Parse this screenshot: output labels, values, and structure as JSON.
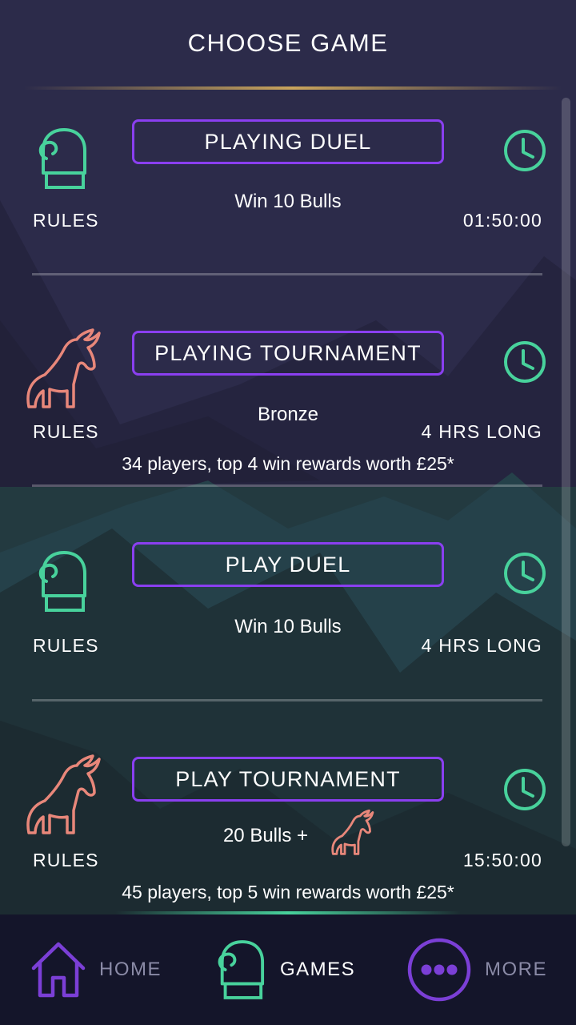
{
  "header": {
    "title": "CHOOSE GAME"
  },
  "cards": [
    {
      "button_label": "PLAYING DUEL",
      "subtitle": "Win 10 Bulls",
      "rules_label": "RULES",
      "time_label": "01:50:00",
      "icon": "boxing-glove-icon"
    },
    {
      "button_label": "PLAYING TOURNAMENT",
      "subtitle": "Bronze",
      "rules_label": "RULES",
      "time_label": "4 HRS LONG",
      "players_text": "34 players, top 4 win rewards worth £25*",
      "icon": "bull-icon"
    },
    {
      "button_label": "PLAY DUEL",
      "subtitle": "Win 10 Bulls",
      "rules_label": "RULES",
      "time_label": "4 HRS LONG",
      "icon": "boxing-glove-icon"
    },
    {
      "button_label": "PLAY TOURNAMENT",
      "subtitle": "20 Bulls +",
      "rules_label": "RULES",
      "time_label": "15:50:00",
      "players_text": "45 players, top 5 win rewards worth £25*",
      "icon": "bull-icon"
    }
  ],
  "nav": {
    "items": [
      {
        "label": "HOME",
        "icon": "home-icon",
        "color": "#7b3fd6"
      },
      {
        "label": "GAMES",
        "icon": "boxing-glove-icon",
        "color": "#48d29c"
      },
      {
        "label": "MORE",
        "icon": "more-dots-icon",
        "color": "#7b3fd6"
      }
    ]
  },
  "colors": {
    "accent_purple": "#8a3ff0",
    "accent_green": "#48d29c",
    "bull_salmon": "#e8877a"
  }
}
